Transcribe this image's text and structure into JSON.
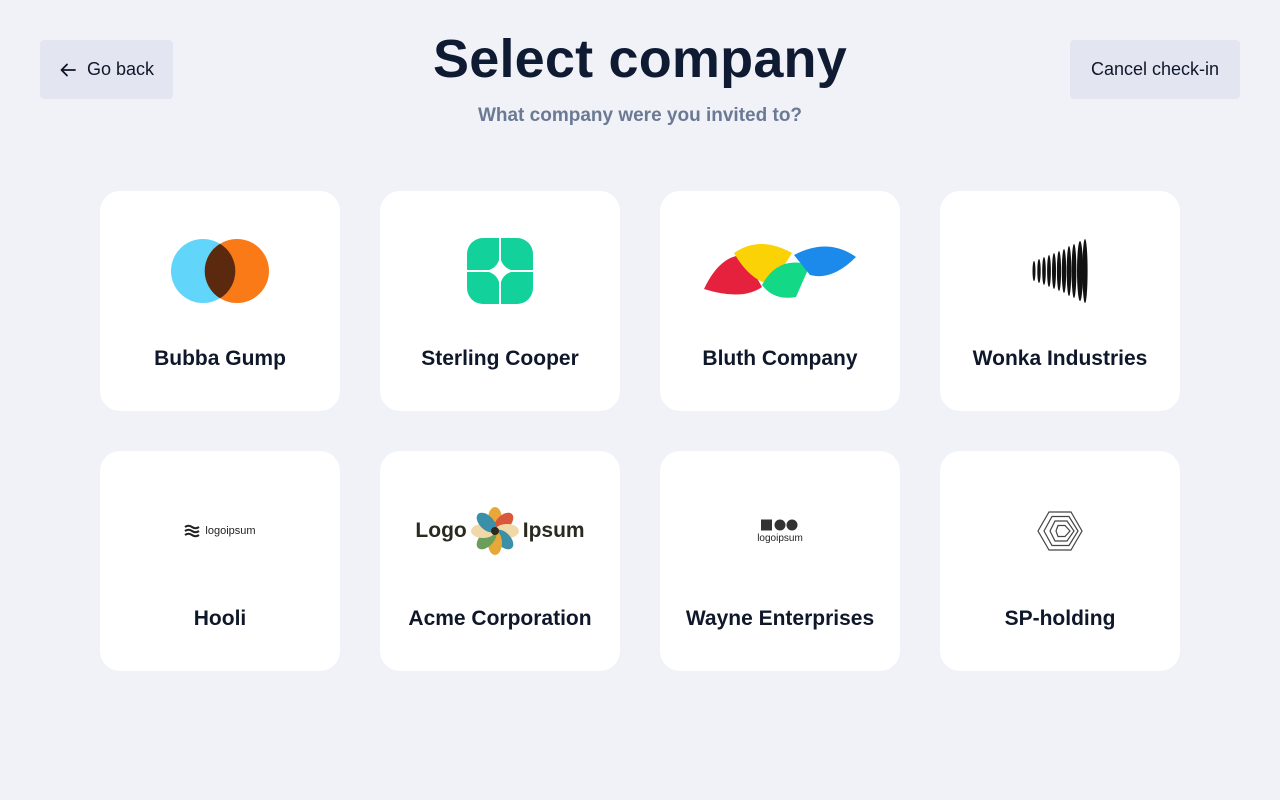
{
  "header": {
    "back_label": "Go back",
    "cancel_label": "Cancel check-in",
    "title": "Select company",
    "subtitle": "What company were you invited to?"
  },
  "companies": [
    {
      "name": "Bubba Gump",
      "icon": "overlapping-circles-logo-icon"
    },
    {
      "name": "Sterling Cooper",
      "icon": "four-petal-logo-icon"
    },
    {
      "name": "Bluth Company",
      "icon": "colorful-leaves-logo-icon"
    },
    {
      "name": "Wonka Industries",
      "icon": "vertical-lines-logo-icon"
    },
    {
      "name": "Hooli",
      "icon": "logoipsum-waves-logo-icon",
      "logo_text": "logoipsum"
    },
    {
      "name": "Acme Corporation",
      "icon": "logo-ipsum-flower-logo-icon",
      "logo_text_left": "Logo",
      "logo_text_right": "Ipsum"
    },
    {
      "name": "Wayne Enterprises",
      "icon": "logoipsum-shapes-logo-icon",
      "logo_text": "logoipsum"
    },
    {
      "name": "SP-holding",
      "icon": "hexagon-logo-icon"
    }
  ],
  "colors": {
    "background": "#f1f2f7",
    "button": "#e3e5f1",
    "card": "#ffffff",
    "title": "#0f1b33",
    "subtitle": "#6b7a94"
  }
}
